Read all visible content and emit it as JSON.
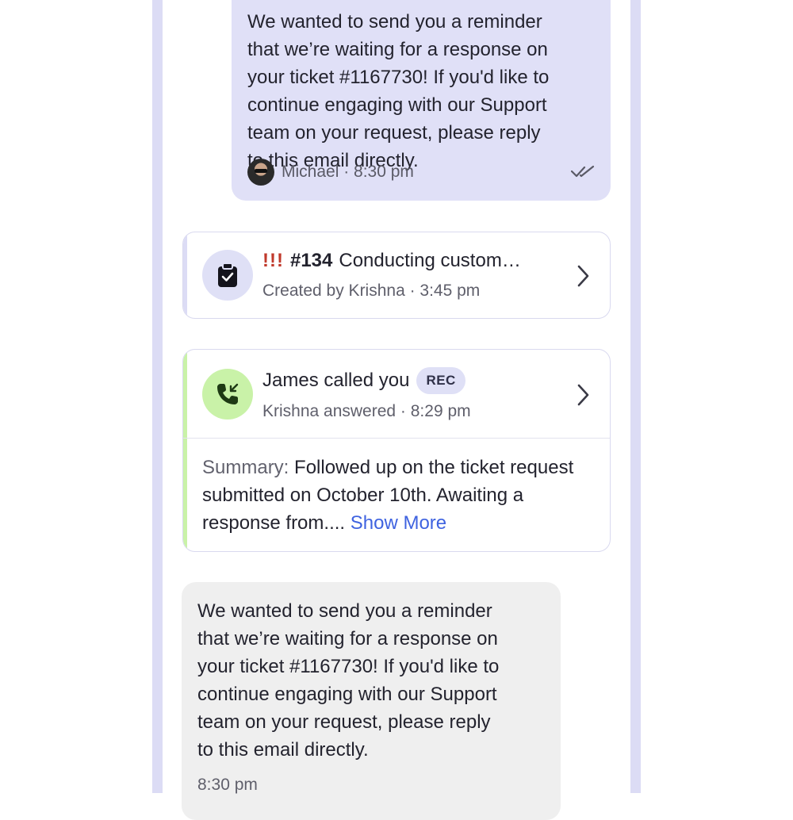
{
  "outgoing_message": {
    "text": "We wanted to send you a reminder\nthat we’re waiting for a response on\nyour ticket #1167730! If you'd like to\ncontinue engaging with our Support\nteam on your request, please reply\nto this email directly.",
    "sender": "Michael",
    "separator": " · ",
    "time": "8:30 pm",
    "status_icon": "double-check-icon"
  },
  "task_card": {
    "priority": "!!!",
    "ticket_number": "#134",
    "title": "Conducting custom…",
    "subtitle": "Created by Krishna · 3:45 pm",
    "icon": "clipboard-check-icon",
    "accent_color": "#dcdcf5"
  },
  "call_card": {
    "title": "James called you",
    "badge": "REC",
    "subtitle": "Krishna answered · 8:29 pm",
    "icon": "incoming-call-icon",
    "accent_color": "#c9f2a8",
    "summary_label": "Summary:",
    "summary_text": " Followed up on the ticket request submitted on October 10th. Awaiting a response from.... ",
    "show_more": "Show More"
  },
  "incoming_message": {
    "text": "We wanted to send you a reminder\nthat we’re waiting for a response on\nyour ticket #1167730! If you'd like to\ncontinue engaging with our Support\nteam on your request, please reply\nto this email directly.",
    "time": "8:30 pm"
  }
}
